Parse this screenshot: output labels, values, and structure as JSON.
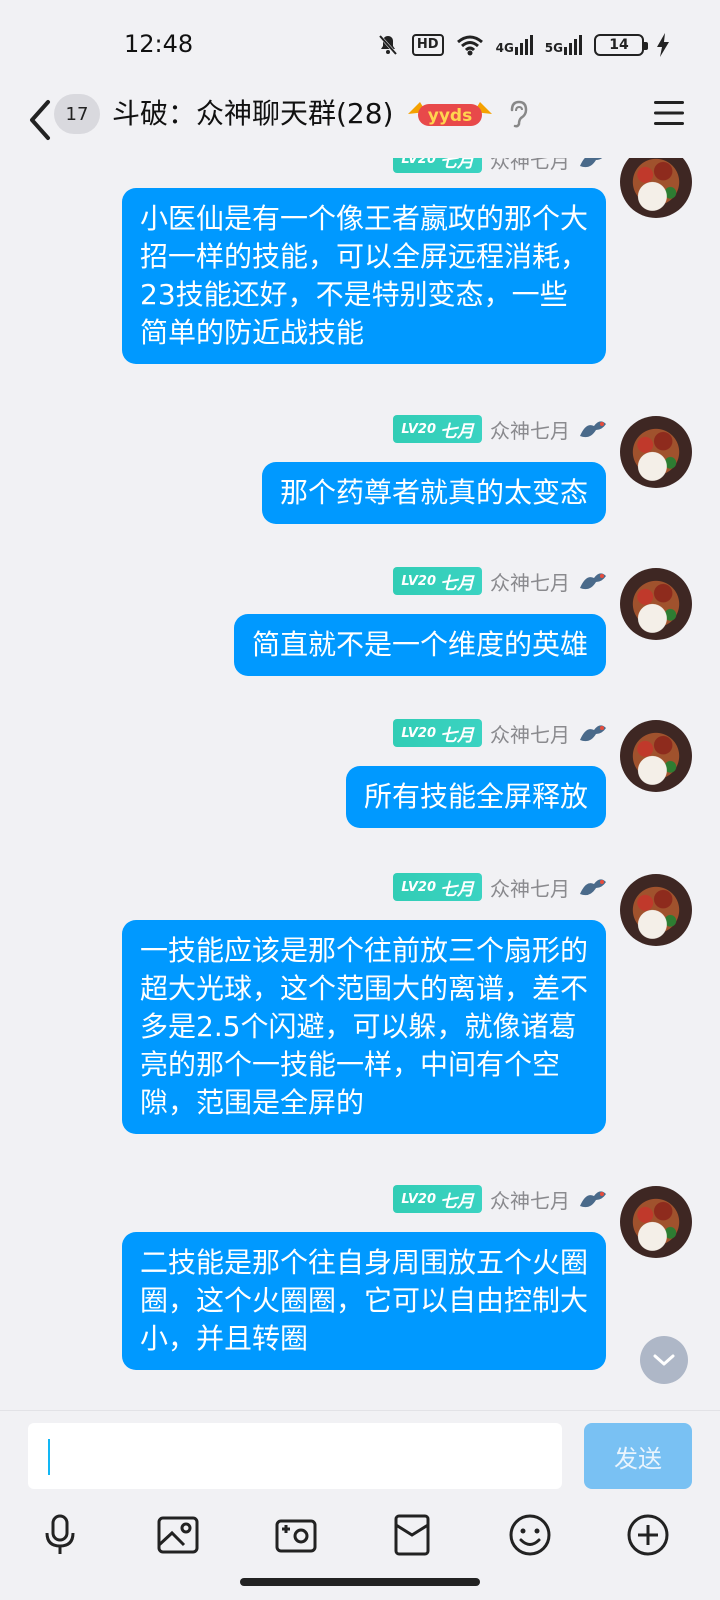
{
  "status_bar": {
    "time": "12:48",
    "network1": "4G",
    "network2": "5G",
    "battery": "14",
    "icons": [
      "mute-icon",
      "hd-icon",
      "wifi-icon",
      "signal-icon",
      "battery-icon",
      "charging-icon"
    ]
  },
  "header": {
    "unread_count": "17",
    "title": "斗破：众神聊天群(28)",
    "badge_text": "yyds",
    "icons": [
      "back-icon",
      "yyds-badge",
      "ear-icon",
      "menu-icon"
    ]
  },
  "sender": {
    "level": "LV20",
    "title": "七月",
    "nickname": "众神七月"
  },
  "messages": [
    {
      "text": "小医仙是有一个像王者嬴政的那个大招一样的技能，可以全屏远程消耗，23技能还好，不是特别变态，一些简单的防近战技能"
    },
    {
      "text": "那个药尊者就真的太变态"
    },
    {
      "text": "简直就不是一个维度的英雄"
    },
    {
      "text": "所有技能全屏释放"
    },
    {
      "text": "一技能应该是那个往前放三个扇形的超大光球，这个范围大的离谱，差不多是2.5个闪避，可以躲，就像诸葛亮的那个一技能一样，中间有个空隙，范围是全屏的"
    },
    {
      "text": "二技能是那个往自身周围放五个火圈圈，这个火圈圈，它可以自由控制大小，并且转圈"
    }
  ],
  "input": {
    "value": "",
    "send_label": "发送"
  },
  "toolbar": {
    "icons": [
      "microphone-icon",
      "image-icon",
      "camera-icon",
      "red-packet-icon",
      "emoji-icon",
      "plus-icon"
    ]
  },
  "colors": {
    "bubble": "#0099ff",
    "background": "#f1f1f4",
    "level_badge": "#31cdb5",
    "send_button": "#79c1f3"
  }
}
